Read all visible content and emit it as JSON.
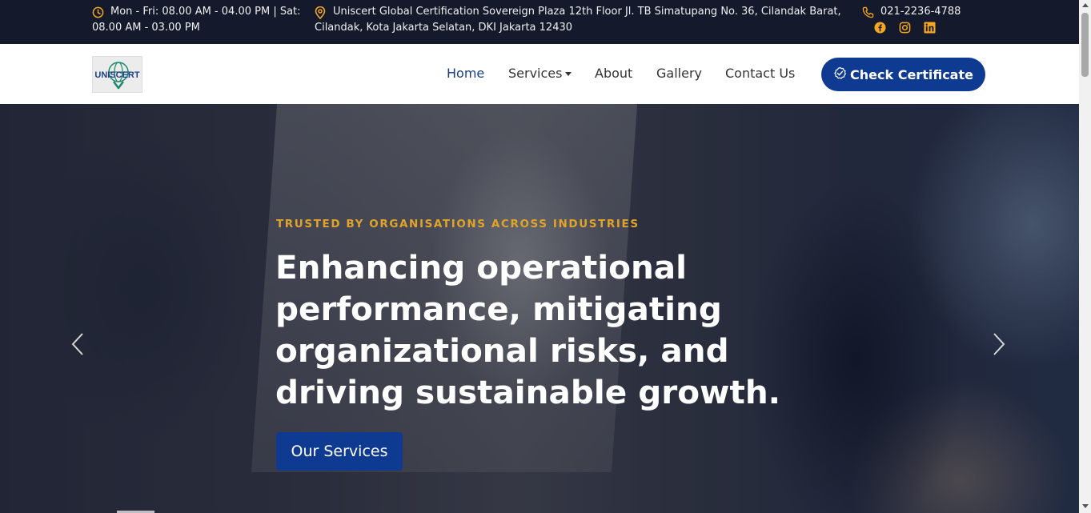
{
  "topbar": {
    "hours": "Mon - Fri: 08.00 AM - 04.00 PM  |  Sat: 08.00 AM - 03.00 PM",
    "address": "Uniscert Global Certification Sovereign Plaza 12th Floor Jl. TB Simatupang No. 36, Cilandak Barat, Cilandak, Kota Jakarta Selatan, DKI Jakarta 12430",
    "phone": "021-2236-4788",
    "icons": {
      "hours": "clock-icon",
      "address": "map-pin-icon",
      "phone": "phone-icon"
    },
    "social": [
      "facebook-icon",
      "instagram-icon",
      "linkedin-icon"
    ],
    "accent_color": "#f5a623"
  },
  "navbar": {
    "logo_text": "UNISCERT",
    "items": [
      {
        "label": "Home",
        "active": true
      },
      {
        "label": "Services"
      },
      {
        "label": "About"
      },
      {
        "label": "Gallery"
      },
      {
        "label": "Contact Us"
      }
    ],
    "cta_label": "Check Certificate",
    "cta_color": "#0f3a91"
  },
  "hero": {
    "eyebrow": "TRUSTED BY ORGANISATIONS ACROSS INDUSTRIES",
    "title": "Enhancing operational performance, mitigating organizational risks, and driving sustainable growth.",
    "button_label": "Our Services",
    "eyebrow_color": "#e2a32a"
  }
}
